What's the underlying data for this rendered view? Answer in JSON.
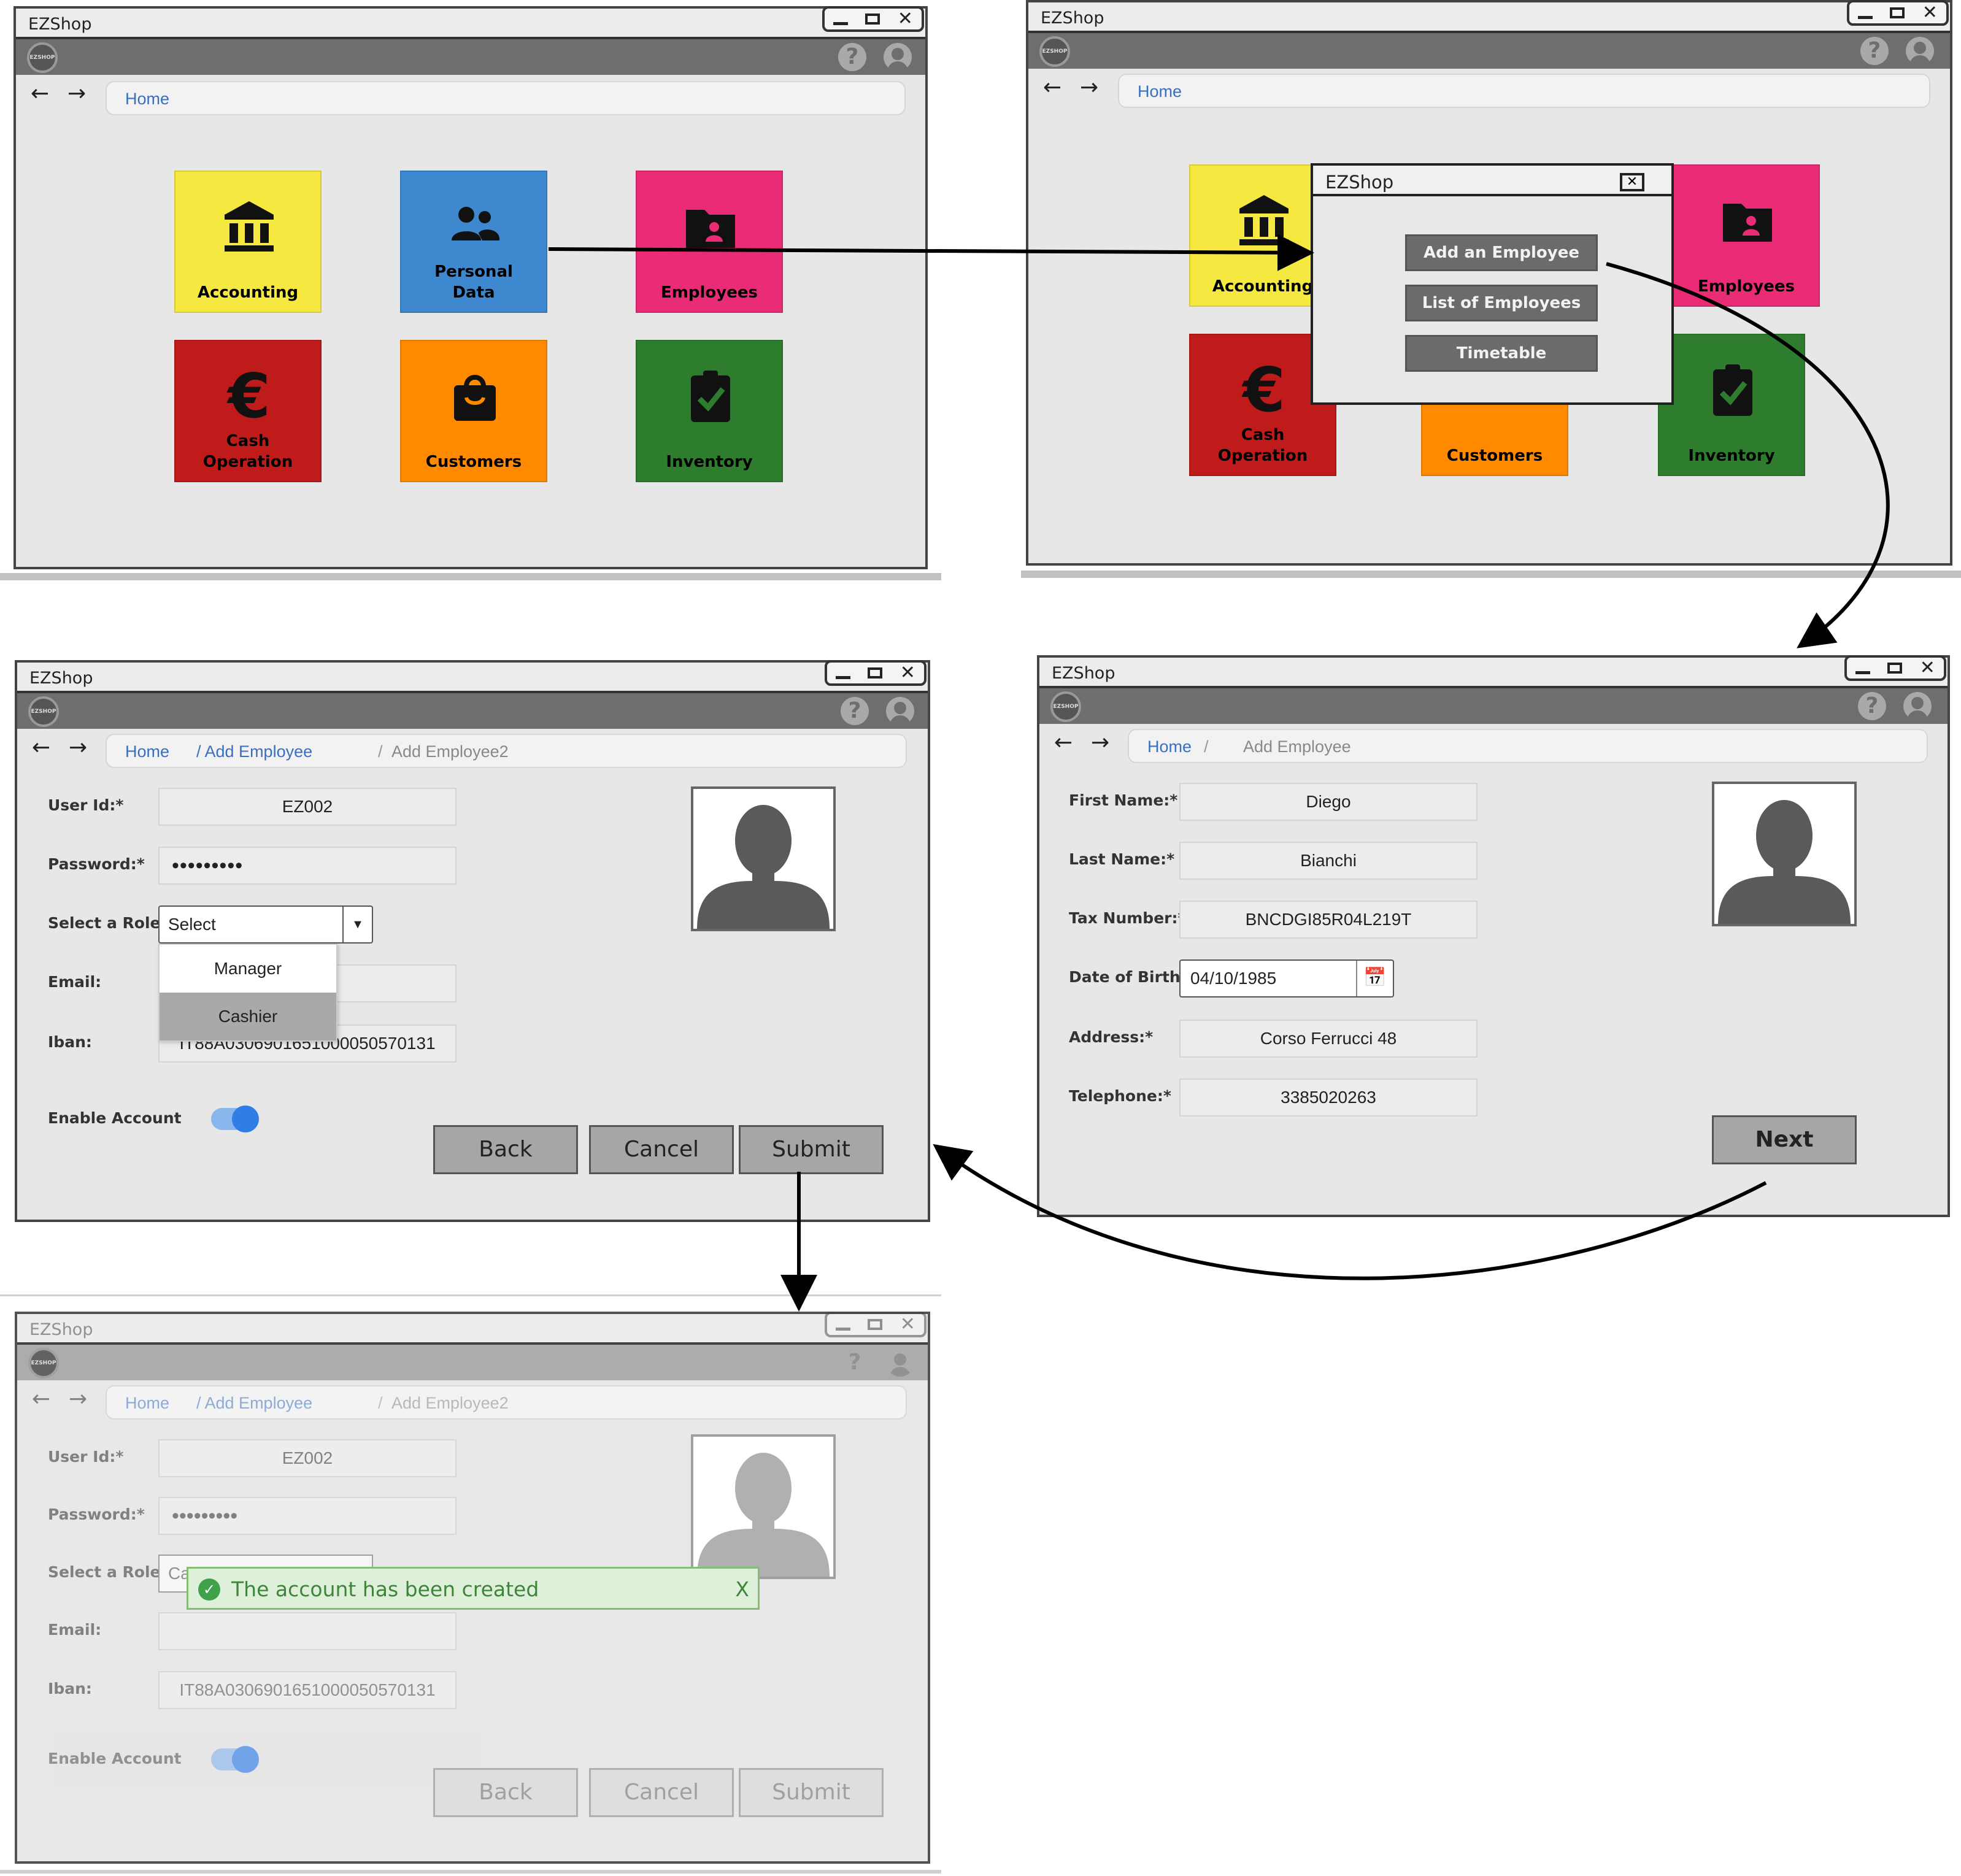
{
  "app": {
    "window_title": "EZShop",
    "logo_text": "EZSHOP"
  },
  "icons": {
    "help": "help-icon",
    "user": "user-icon",
    "back": "arrow-left-icon",
    "forward": "arrow-right-icon"
  },
  "colors": {
    "accounting": "#f4e841",
    "personal_data": "#3d88cf",
    "employees": "#ea2c76",
    "cash_operation": "#bf1b1b",
    "customers": "#ff8a00",
    "inventory": "#2e7d2e",
    "toast_bg": "#dcefd6",
    "toggle": "#2f7ee8"
  },
  "home": {
    "breadcrumb": "Home",
    "tiles": {
      "accounting": "Accounting",
      "personal_data_1": "Personal",
      "personal_data_2": "Data",
      "employees": "Employees",
      "cash_1": "Cash",
      "cash_2": "Operation",
      "customers": "Customers",
      "inventory": "Inventory"
    }
  },
  "menu_dialog": {
    "title": "EZShop",
    "items": [
      "Add an Employee",
      "List of Employees",
      "Timetable"
    ]
  },
  "add_employee": {
    "breadcrumb": [
      "Home",
      "/",
      "Add Employee"
    ],
    "labels": {
      "first_name": "First Name:*",
      "last_name": "Last Name:*",
      "tax": "Tax Number:*",
      "dob": "Date of Birth:*",
      "address": "Address:*",
      "phone": "Telephone:*"
    },
    "values": {
      "first_name": "Diego",
      "last_name": "Bianchi",
      "tax": "BNCDGI85R04L219T",
      "dob": "04/10/1985",
      "address": "Corso Ferrucci 48",
      "phone": "3385020263"
    },
    "next": "Next"
  },
  "add_employee2": {
    "breadcrumb": [
      "Home",
      "/ Add Employee",
      "/",
      "Add Employee2"
    ],
    "labels": {
      "user_id": "User Id:*",
      "password": "Password:*",
      "role": "Select a Role:*",
      "email": "Email:",
      "iban": "Iban:",
      "enable": "Enable Account"
    },
    "values": {
      "user_id": "EZ002",
      "password": "•••••••••",
      "role": "Select",
      "email": "",
      "iban": "IT88A0306901651000050570131"
    },
    "role_options": [
      "Manager",
      "Cashier"
    ],
    "buttons": {
      "back": "Back",
      "cancel": "Cancel",
      "submit": "Submit"
    }
  },
  "confirmation": {
    "role_partial": "Ca",
    "toast": "The account has been created",
    "toast_close": "X"
  }
}
